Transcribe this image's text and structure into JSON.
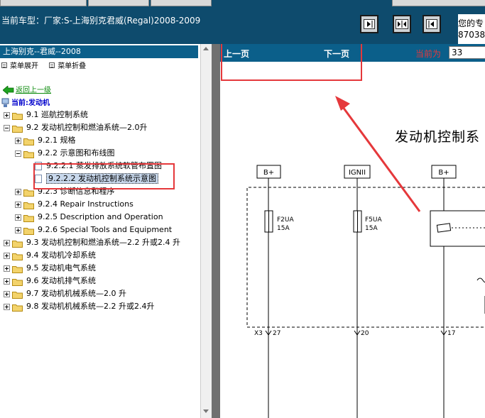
{
  "header": {
    "car_label": "当前车型：厂家:S-上海别克君威(Regal)2008-2009",
    "info_line1": "您的专",
    "info_line2": "870382"
  },
  "left_panel": {
    "title": "上海别克--君威--2008",
    "expand_all": "菜单展开",
    "collapse_all": "菜单折叠",
    "back_link": "返回上一级",
    "current": "当前:发动机",
    "tree": [
      {
        "label": "9.1 巡航控制系统",
        "expander": "plus",
        "icon": "folder"
      },
      {
        "label": "9.2 发动机控制和燃油系统—2.0升",
        "expander": "minus",
        "icon": "folder-open"
      },
      {
        "label": "9.2.1 规格",
        "expander": "plus",
        "icon": "folder"
      },
      {
        "label": "9.2.2 示意图和布线图",
        "expander": "minus",
        "icon": "folder-open"
      },
      {
        "label": "9.2.2.1 蒸发排放系统软管布置图",
        "expander": "none",
        "icon": "doc"
      },
      {
        "label": "9.2.2.2 发动机控制系统示意图",
        "expander": "none",
        "icon": "doc",
        "selected": true
      },
      {
        "label": "9.2.3 诊断信息和程序",
        "expander": "plus",
        "icon": "folder"
      },
      {
        "label": "9.2.4 Repair Instructions",
        "expander": "plus",
        "icon": "folder"
      },
      {
        "label": "9.2.5 Description and Operation",
        "expander": "plus",
        "icon": "folder"
      },
      {
        "label": "9.2.6 Special Tools and Equipment",
        "expander": "plus",
        "icon": "folder"
      },
      {
        "label": "9.3 发动机控制和燃油系统—2.2 升或2.4 升",
        "expander": "plus",
        "icon": "folder"
      },
      {
        "label": "9.4 发动机冷却系统",
        "expander": "plus",
        "icon": "folder"
      },
      {
        "label": "9.5 发动机电气系统",
        "expander": "plus",
        "icon": "folder"
      },
      {
        "label": "9.6 发动机排气系统",
        "expander": "plus",
        "icon": "folder"
      },
      {
        "label": "9.7 发动机机械系统—2.0 升",
        "expander": "plus",
        "icon": "folder"
      },
      {
        "label": "9.8 发动机机械系统—2.2 升或2.4升",
        "expander": "plus",
        "icon": "folder"
      }
    ]
  },
  "doc_panel": {
    "prev_page": "上一页",
    "next_page": "下一页",
    "current_page_label": "当前为",
    "current_page_value": "33",
    "diagram_title": "发动机控制系",
    "power_labels": [
      "B+",
      "IGNII",
      "B+"
    ],
    "fuses": [
      {
        "name": "F2UA",
        "rating": "15A"
      },
      {
        "name": "F5UA",
        "rating": "15A"
      }
    ],
    "connector": "X3",
    "pins": [
      "27",
      "20",
      "17"
    ]
  },
  "colors": {
    "header_bg": "#0e4b6d",
    "title_bar_bg": "#0b5f8a",
    "annotation_red": "#e5383b",
    "link_green": "#0a8a0a",
    "current_blue": "#0000cc"
  }
}
